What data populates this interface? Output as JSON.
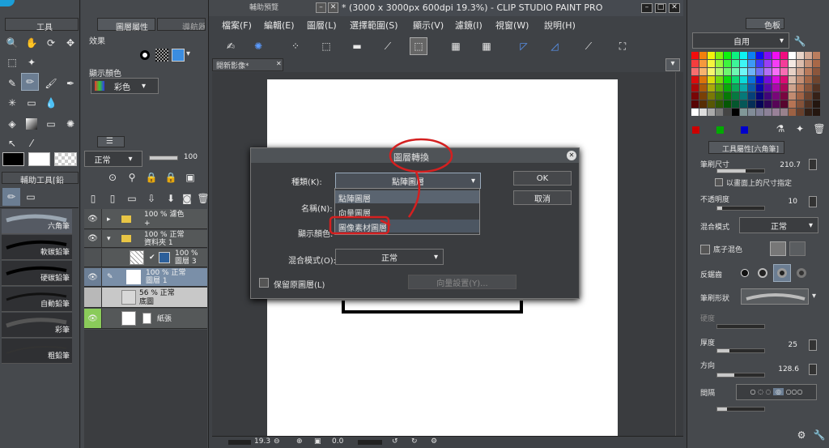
{
  "tool_panel": {
    "tab": "工具",
    "bottom_tab": "輔助工具[鉛",
    "effect_label": "效果",
    "color_label": "顯示顏色",
    "color_value": "彩色"
  },
  "prop_panel": {
    "tab1": "圖層屬性",
    "tab2": "導航器"
  },
  "nav_panel": {
    "title": "輔助預覽"
  },
  "brushes": [
    "六角筆",
    "軟碳鉛筆",
    "硬碳鉛筆",
    "自動鉛筆",
    "彩筆",
    "粗鉛筆"
  ],
  "layer_panel": {
    "blend": "正常",
    "opacity": "100"
  },
  "layers": [
    {
      "pct": "100 %",
      "mode": "濾色",
      "name": "+"
    },
    {
      "pct": "100 %",
      "mode": "正常",
      "name": "資料夾 1"
    },
    {
      "pct": "100 %",
      "mode": "",
      "name": "圖層 3"
    },
    {
      "pct": "100 %",
      "mode": "正常",
      "name": "圖層 1"
    },
    {
      "pct": "56 %",
      "mode": "正常",
      "name": "底圖"
    },
    {
      "pct": "",
      "mode": "",
      "name": "紙張"
    }
  ],
  "window": {
    "title": "* (3000 x 3000px 600dpi 19.3%) - CLIP STUDIO PAINT PRO"
  },
  "menu": [
    "檔案(F)",
    "編輯(E)",
    "圖層(L)",
    "選擇範圍(S)",
    "顯示(V)",
    "濾鏡(I)",
    "視窗(W)",
    "說明(H)"
  ],
  "canvas_tab": "開新影像*",
  "status": {
    "zoom": "19.3",
    "pos": "0.0"
  },
  "dialog": {
    "title": "圖層轉換",
    "type_label": "種類(K):",
    "type_value": "點陣圖層",
    "name_label": "名稱(N):",
    "color_label": "顯示顏色:",
    "blend_label": "混合模式(O):",
    "blend_value": "正常",
    "keep_label": "保留原圖層(L)",
    "vector_btn": "向量設置(Y)...",
    "ok": "OK",
    "cancel": "取消",
    "options": [
      "點陣圖層",
      "向量圖層",
      "圖像素材圖層"
    ]
  },
  "color_panel": {
    "dropdown": "自用",
    "tab": "色板"
  },
  "tool_prop": {
    "title": "工具屬性[六角筆]",
    "brush_size": "筆刷尺寸",
    "brush_size_val": "210.7",
    "size_check": "以畫面上的尺寸指定",
    "opacity": "不透明度",
    "opacity_val": "10",
    "blend": "混合模式",
    "blend_val": "正常",
    "base_mix": "底子混色",
    "anti": "反鋸齒",
    "brush_shape": "筆刷形狀",
    "hardness": "硬度",
    "thickness": "厚度",
    "thickness_val": "25",
    "direction": "方向",
    "direction_val": "128.6",
    "interval": "間隔"
  },
  "colors": {
    "accent": "#d42020",
    "selected_layer": "#7a8fa8",
    "panel": "#3f4246"
  }
}
